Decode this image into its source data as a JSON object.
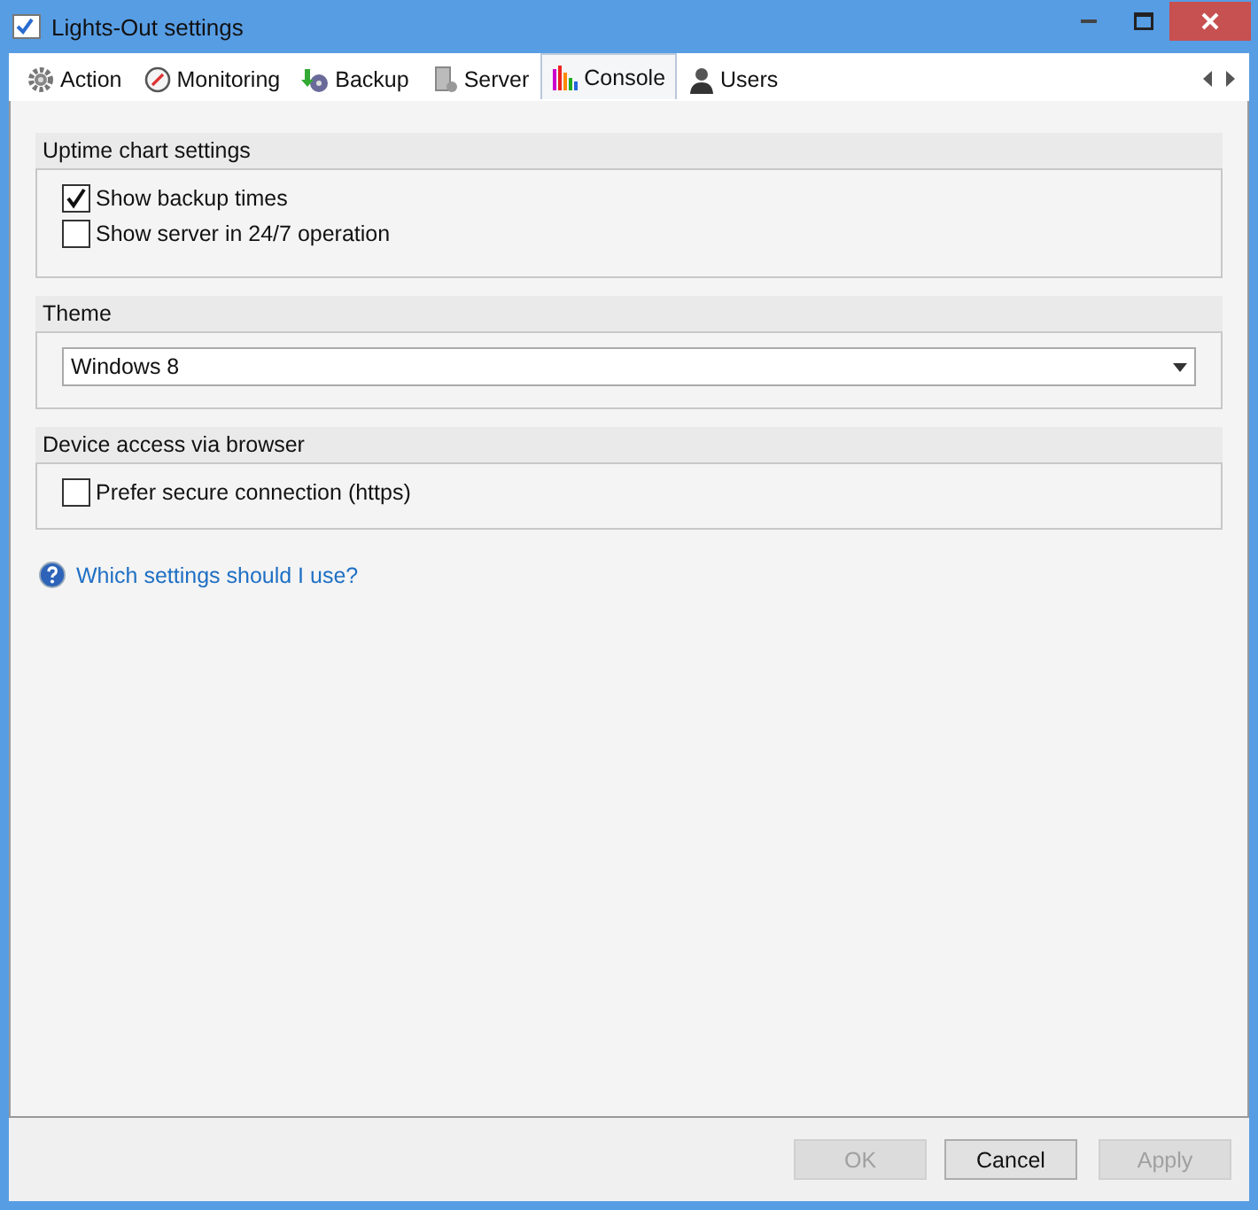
{
  "window": {
    "title": "Lights-Out settings"
  },
  "tabs": [
    {
      "label": "Action",
      "selected": false
    },
    {
      "label": "Monitoring",
      "selected": false
    },
    {
      "label": "Backup",
      "selected": false
    },
    {
      "label": "Server",
      "selected": false
    },
    {
      "label": "Console",
      "selected": true
    },
    {
      "label": "Users",
      "selected": false
    }
  ],
  "sections": [
    {
      "title": "Uptime chart settings",
      "kind": "checkboxes",
      "items": [
        {
          "label": "Show backup times",
          "checked": true
        },
        {
          "label": "Show server in 24/7 operation",
          "checked": false
        }
      ]
    },
    {
      "title": "Theme",
      "kind": "dropdown",
      "value": "Windows 8"
    },
    {
      "title": "Device access via browser",
      "kind": "checkboxes",
      "items": [
        {
          "label": "Prefer secure connection (https)",
          "checked": false
        }
      ]
    }
  ],
  "help_link": "Which settings should I use?",
  "buttons": [
    {
      "label": "OK",
      "disabled": true
    },
    {
      "label": "Cancel",
      "disabled": false
    },
    {
      "label": "Apply",
      "disabled": true
    }
  ]
}
